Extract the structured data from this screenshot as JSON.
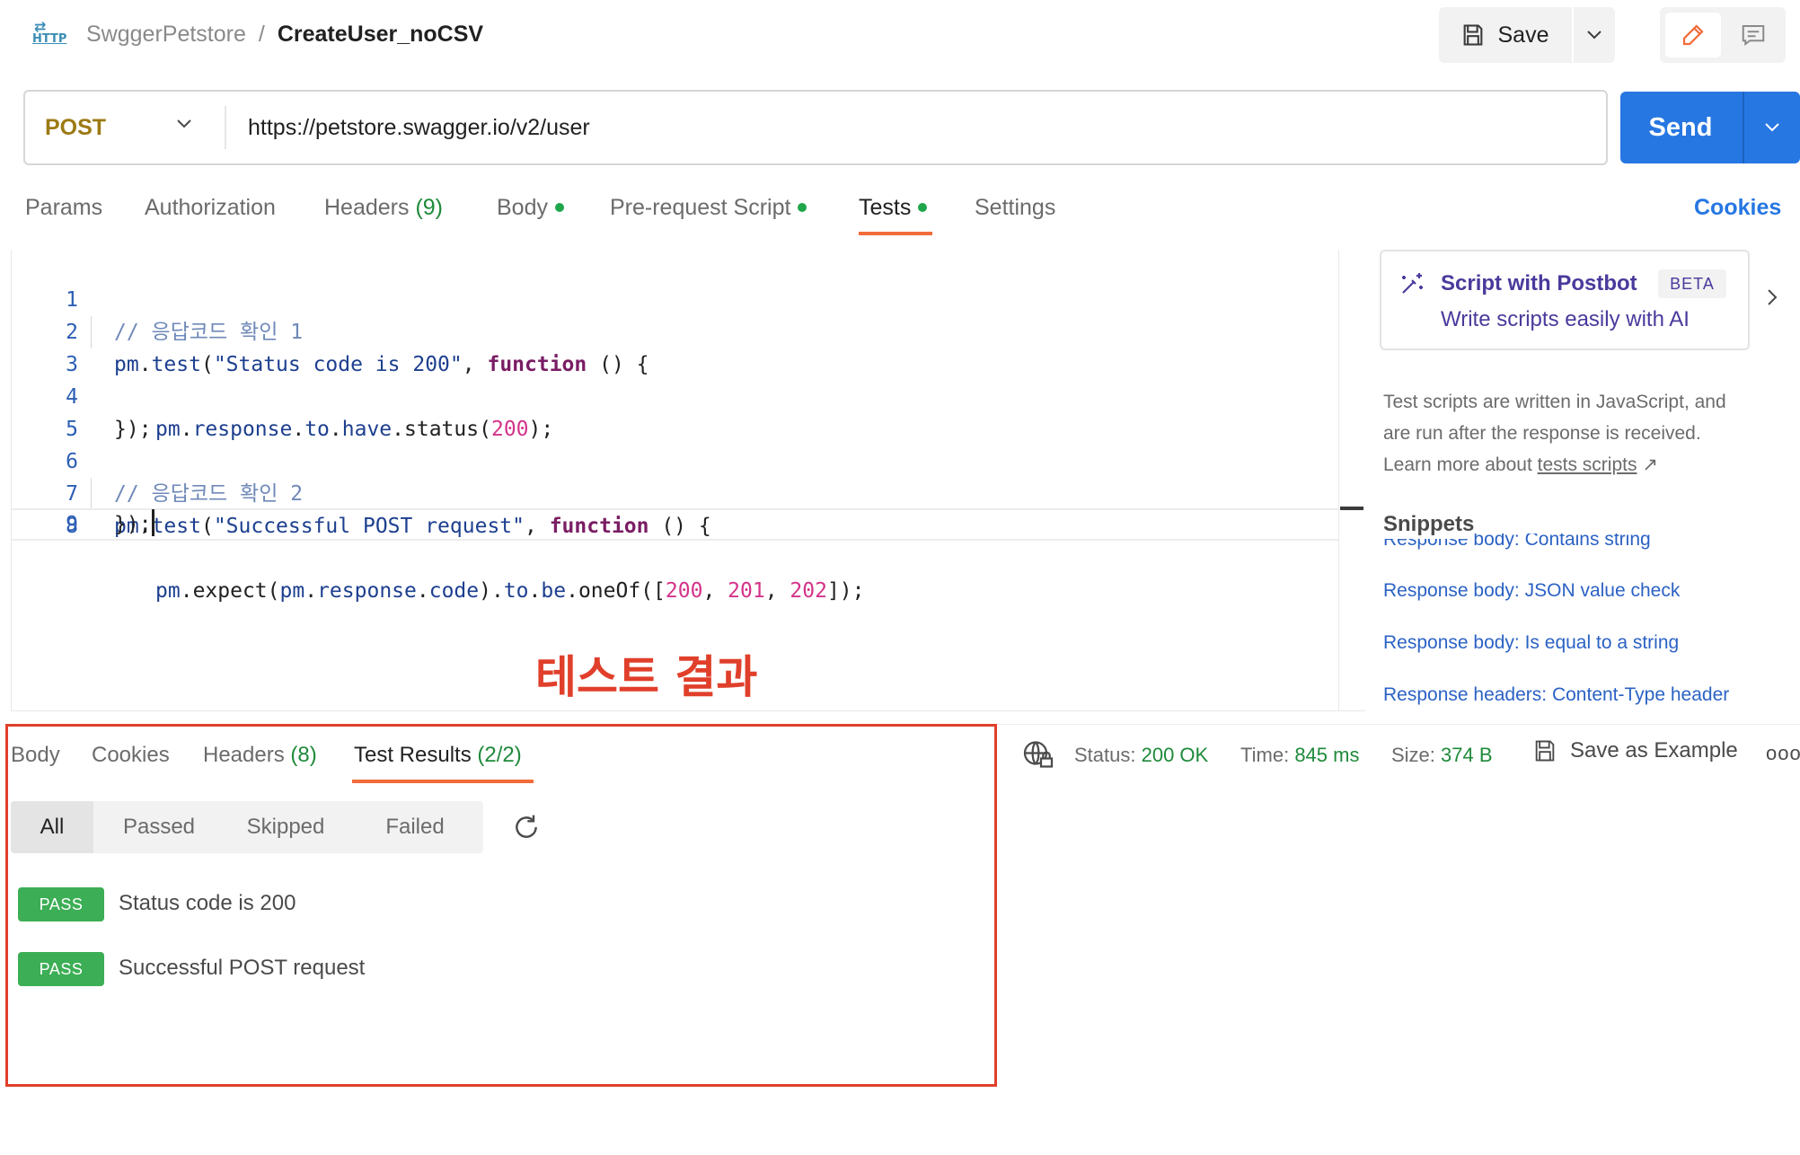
{
  "header": {
    "request_icon_text": "HTTP",
    "breadcrumb_parent": "SwggerPetstore",
    "breadcrumb_separator": "/",
    "breadcrumb_current": "CreateUser_noCSV",
    "save_label": "Save"
  },
  "request": {
    "method": "POST",
    "url": "https://petstore.swagger.io/v2/user",
    "send_label": "Send",
    "method_color": "#9c7a14",
    "send_color": "#2677e2"
  },
  "request_tabs": {
    "params": "Params",
    "authorization": "Authorization",
    "headers": "Headers",
    "headers_count": "(9)",
    "body": "Body",
    "pre_request": "Pre-request Script",
    "tests": "Tests",
    "settings": "Settings",
    "cookies": "Cookies",
    "active": "Tests"
  },
  "editor": {
    "lines": [
      {
        "num": "1",
        "comment": "// 응답코드 확인 1"
      },
      {
        "num": "2",
        "obj": "pm",
        "dot": ".",
        "fn": "test",
        "open": "(",
        "str": "\"Status code is 200\"",
        "comma": ", ",
        "kw": "function",
        "rest": " () {"
      },
      {
        "num": "3",
        "obj1": "pm",
        "d1": ".",
        "obj2": "response",
        "d2": ".",
        "obj3": "to",
        "d3": ".",
        "obj4": "have",
        "d4": ".",
        "fn": "status",
        "open": "(",
        "n1": "200",
        "close": ");"
      },
      {
        "num": "4",
        "plain": "});"
      },
      {
        "num": "5"
      },
      {
        "num": "6",
        "comment": "// 응답코드 확인 2"
      },
      {
        "num": "7",
        "obj": "pm",
        "dot": ".",
        "fn": "test",
        "open": "(",
        "str": "\"Successful POST request\"",
        "comma": ", ",
        "kw": "function",
        "rest": " () {"
      },
      {
        "num": "8",
        "obj1": "pm",
        "d1": ".",
        "fn1": "expect",
        "open1": "(",
        "obj2": "pm",
        "d2": ".",
        "obj3": "response",
        "d3": ".",
        "obj4": "code",
        "close1": ").",
        "obj5": "to",
        "d5": ".",
        "obj6": "be",
        "d6": ".",
        "fn2": "oneOf",
        "open2": "([",
        "n1": "200",
        "c1": ", ",
        "n2": "201",
        "c2": ", ",
        "n3": "202",
        "close2": "]);"
      },
      {
        "num": "9",
        "plain": "});"
      }
    ]
  },
  "annotation": "테스트 결과",
  "side_panel": {
    "postbot_title": "Script with Postbot",
    "beta": "BETA",
    "postbot_sub": "Write scripts easily with AI",
    "desc_line1": "Test scripts are written in JavaScript, and",
    "desc_line2": "are run after the response is received.",
    "desc_line3": "Learn more about",
    "desc_link": "tests scripts",
    "desc_arrow": "↗",
    "snippets_title": "Snippets",
    "snippets": [
      "Response body: Contains string",
      "Response body: JSON value check",
      "Response body: Is equal to a string",
      "Response headers: Content-Type header"
    ]
  },
  "response": {
    "tabs": {
      "body": "Body",
      "cookies": "Cookies",
      "headers": "Headers",
      "headers_count": "(8)",
      "test_results": "Test Results",
      "test_results_count": "(2/2)"
    },
    "filters": [
      "All",
      "Passed",
      "Skipped",
      "Failed"
    ],
    "active_filter": "All",
    "results": [
      {
        "status": "PASS",
        "name": "Status code is 200"
      },
      {
        "status": "PASS",
        "name": "Successful POST request"
      }
    ],
    "status_label": "Status:",
    "status_value": "200 OK",
    "time_label": "Time:",
    "time_value": "845 ms",
    "size_label": "Size:",
    "size_value": "374 B",
    "save_example": "Save as Example",
    "more": "ooo",
    "pass_color": "#3cae55",
    "highlight_color": "#e03f2b"
  }
}
